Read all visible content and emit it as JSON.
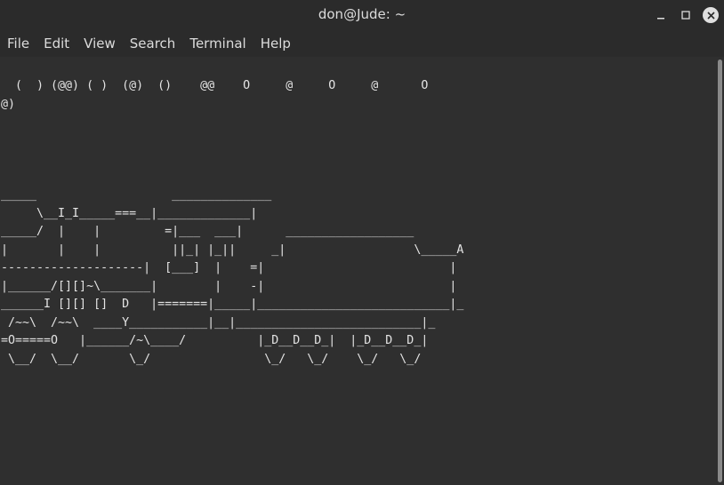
{
  "window": {
    "title": "don@Jude: ~",
    "controls": {
      "minimize": "–",
      "maximize": "□",
      "close": "✕"
    }
  },
  "menu": {
    "file": "File",
    "edit": "Edit",
    "view": "View",
    "search": "Search",
    "terminal": "Terminal",
    "help": "Help"
  },
  "terminal": {
    "output": "  (  ) (@@) ( )  (@)  ()    @@    O     @     O     @      O\n@)\n\n\n\n\n_____                   ______________\n     \\__I_I_____===__|_____________|\n_____/  |    |         =|___  ___|      __________________\n|       |    |          ||_| |_||     _|                  \\_____A\n--------------------|  [___]  |    =|                          |\n|______/[][]~\\_______|        |    -|                          |\n______I [][] []  D   |=======|_____|___________________________|_\n /~~\\  /~~\\  ____Y___________|__|__________________________|_\n=O=====O   |______/~\\____/          |_D__D__D_|  |_D__D__D_|\n \\__/  \\__/       \\_/                \\_/   \\_/    \\_/   \\_/"
  }
}
